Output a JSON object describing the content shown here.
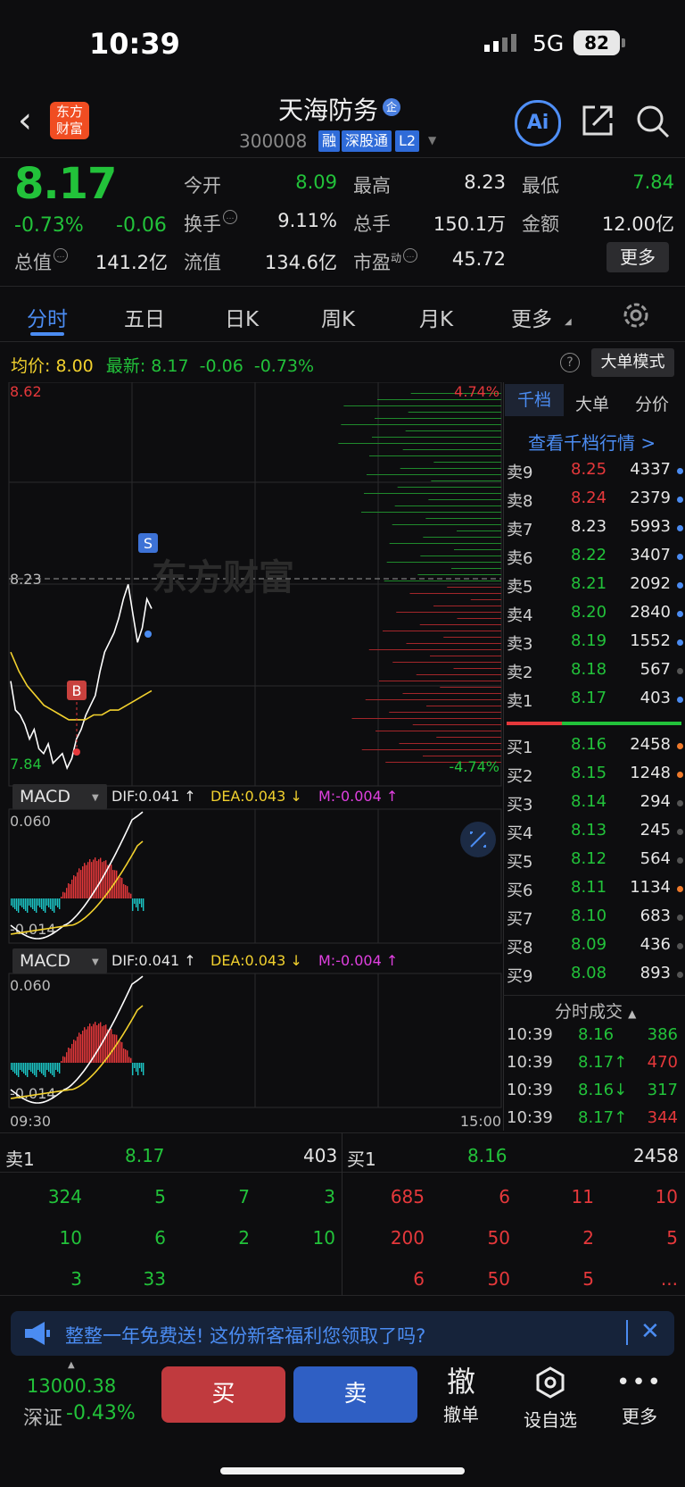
{
  "status_bar": {
    "time": "10:39",
    "network": "5G",
    "battery": "82"
  },
  "header": {
    "logo_line1": "东方",
    "logo_line2": "财富",
    "name": "天海防务",
    "badge": "企",
    "code": "300008",
    "tags": [
      "融",
      "深股通",
      "L2"
    ],
    "ai_label": "Ai"
  },
  "quote": {
    "price": "8.17",
    "pct": "-0.73%",
    "change": "-0.06",
    "fields": [
      {
        "label": "今开",
        "value": "8.09",
        "color": "#22c23a"
      },
      {
        "label": "最高",
        "value": "8.23",
        "color": "#e6e6e6"
      },
      {
        "label": "最低",
        "value": "7.84",
        "color": "#22c23a"
      },
      {
        "label": "换手",
        "value": "9.11%",
        "color": "#e6e6e6"
      },
      {
        "label": "总手",
        "value": "150.1万",
        "color": "#e6e6e6"
      },
      {
        "label": "金额",
        "value": "12.00亿",
        "color": "#e6e6e6"
      },
      {
        "label": "总值",
        "value": "141.2亿",
        "color": "#e6e6e6"
      },
      {
        "label": "流值",
        "value": "134.6亿",
        "color": "#e6e6e6"
      },
      {
        "label": "市盈",
        "value": "45.72",
        "color": "#e6e6e6"
      }
    ],
    "pe_sup": "动",
    "more": "更多"
  },
  "tabs": [
    "分时",
    "五日",
    "日K",
    "周K",
    "月K",
    "更多"
  ],
  "info_line": {
    "avg_label": "均价:",
    "avg_value": "8.00",
    "last_label": "最新:",
    "last_value": "8.17",
    "last_change": "-0.06",
    "last_pct": "-0.73%",
    "help": "?",
    "big_order_mode": "大单模式"
  },
  "chart_data": {
    "type": "line",
    "y_max_label": "8.62",
    "y_min_label": "7.84",
    "pct_max": "4.74%",
    "pct_min": "-4.74%",
    "ref_line_label": "8.23",
    "start_time": "09:30",
    "end_time": "15:00",
    "watermark": "东方财富",
    "markers": {
      "buy": "B",
      "sell": "S"
    },
    "price_series": [
      8.02,
      7.96,
      7.95,
      7.93,
      7.9,
      7.92,
      7.88,
      7.87,
      7.89,
      7.85,
      7.86,
      7.87,
      7.84,
      7.86,
      7.9,
      7.92,
      7.95,
      7.97,
      7.99,
      8.04,
      8.08,
      8.1,
      8.12,
      8.15,
      8.19,
      8.22,
      8.16,
      8.1,
      8.13,
      8.19,
      8.17
    ],
    "avg_series": [
      8.08,
      8.04,
      8.01,
      7.99,
      7.97,
      7.96,
      7.95,
      7.94,
      7.94,
      7.94,
      7.95,
      7.95,
      7.96,
      7.96,
      7.97,
      7.98,
      7.99,
      8.0
    ]
  },
  "macd": [
    {
      "label": "MACD",
      "dif": "DIF:0.041 ↑",
      "dea": "DEA:0.043 ↓",
      "m": "M:-0.004 ↑",
      "ymax": "0.060",
      "ymin": "-0.014"
    },
    {
      "label": "MACD",
      "dif": "DIF:0.041 ↑",
      "dea": "DEA:0.043 ↓",
      "m": "M:-0.004 ↑",
      "ymax": "0.060",
      "ymin": "-0.014"
    }
  ],
  "right_panel": {
    "tabs": [
      "千档",
      "大单",
      "分价"
    ],
    "link": "查看千档行情 >",
    "asks": [
      {
        "label": "卖9",
        "price": "8.25",
        "vol": "4337",
        "pcolor": "#e5383b",
        "dot": "#4b8cf2"
      },
      {
        "label": "卖8",
        "price": "8.24",
        "vol": "2379",
        "pcolor": "#e5383b",
        "dot": "#4b8cf2"
      },
      {
        "label": "卖7",
        "price": "8.23",
        "vol": "5993",
        "pcolor": "#e6e6e6",
        "dot": "#4b8cf2"
      },
      {
        "label": "卖6",
        "price": "8.22",
        "vol": "3407",
        "pcolor": "#22c23a",
        "dot": "#4b8cf2"
      },
      {
        "label": "卖5",
        "price": "8.21",
        "vol": "2092",
        "pcolor": "#22c23a",
        "dot": "#4b8cf2"
      },
      {
        "label": "卖4",
        "price": "8.20",
        "vol": "2840",
        "pcolor": "#22c23a",
        "dot": "#4b8cf2"
      },
      {
        "label": "卖3",
        "price": "8.19",
        "vol": "1552",
        "pcolor": "#22c23a",
        "dot": "#4b8cf2"
      },
      {
        "label": "卖2",
        "price": "8.18",
        "vol": "567",
        "pcolor": "#22c23a",
        "dot": "#555555"
      },
      {
        "label": "卖1",
        "price": "8.17",
        "vol": "403",
        "pcolor": "#22c23a",
        "dot": "#4b8cf2"
      }
    ],
    "bids": [
      {
        "label": "买1",
        "price": "8.16",
        "vol": "2458",
        "pcolor": "#22c23a",
        "dot": "#ef7a2b"
      },
      {
        "label": "买2",
        "price": "8.15",
        "vol": "1248",
        "pcolor": "#22c23a",
        "dot": "#ef7a2b"
      },
      {
        "label": "买3",
        "price": "8.14",
        "vol": "294",
        "pcolor": "#22c23a",
        "dot": "#555555"
      },
      {
        "label": "买4",
        "price": "8.13",
        "vol": "245",
        "pcolor": "#22c23a",
        "dot": "#555555"
      },
      {
        "label": "买5",
        "price": "8.12",
        "vol": "564",
        "pcolor": "#22c23a",
        "dot": "#555555"
      },
      {
        "label": "买6",
        "price": "8.11",
        "vol": "1134",
        "pcolor": "#22c23a",
        "dot": "#ef7a2b"
      },
      {
        "label": "买7",
        "price": "8.10",
        "vol": "683",
        "pcolor": "#22c23a",
        "dot": "#555555"
      },
      {
        "label": "买8",
        "price": "8.09",
        "vol": "436",
        "pcolor": "#22c23a",
        "dot": "#555555"
      },
      {
        "label": "买9",
        "price": "8.08",
        "vol": "893",
        "pcolor": "#22c23a",
        "dot": "#555555"
      }
    ],
    "ticks_title": "分时成交",
    "ticks": [
      {
        "time": "10:39",
        "price": "8.16",
        "vol": "386",
        "vcolor": "#22c23a"
      },
      {
        "time": "10:39",
        "price": "8.17↑",
        "vol": "470",
        "vcolor": "#e5383b"
      },
      {
        "time": "10:39",
        "price": "8.16↓",
        "vol": "317",
        "vcolor": "#22c23a"
      },
      {
        "time": "10:39",
        "price": "8.17↑",
        "vol": "344",
        "vcolor": "#e5383b"
      }
    ]
  },
  "queue": {
    "ask_label": "卖1",
    "ask_price": "8.17",
    "ask_vol": "403",
    "bid_label": "买1",
    "bid_price": "8.16",
    "bid_vol": "2458",
    "ask_cells": [
      "324",
      "5",
      "7",
      "3",
      "10",
      "6",
      "2",
      "10",
      "3",
      "33"
    ],
    "bid_cells": [
      "685",
      "6",
      "11",
      "10",
      "200",
      "50",
      "2",
      "5",
      "6",
      "50",
      "5",
      "..."
    ]
  },
  "banner": {
    "text": "整整一年免费送! 这份新客福利您领取了吗?"
  },
  "bottom_bar": {
    "index_value": "13000.38",
    "index_name": "深证",
    "index_pct": "-0.43%",
    "buy": "买",
    "sell": "卖",
    "cancel_big": "撤",
    "cancel": "撤单",
    "watchlist": "设自选",
    "more": "更多"
  }
}
